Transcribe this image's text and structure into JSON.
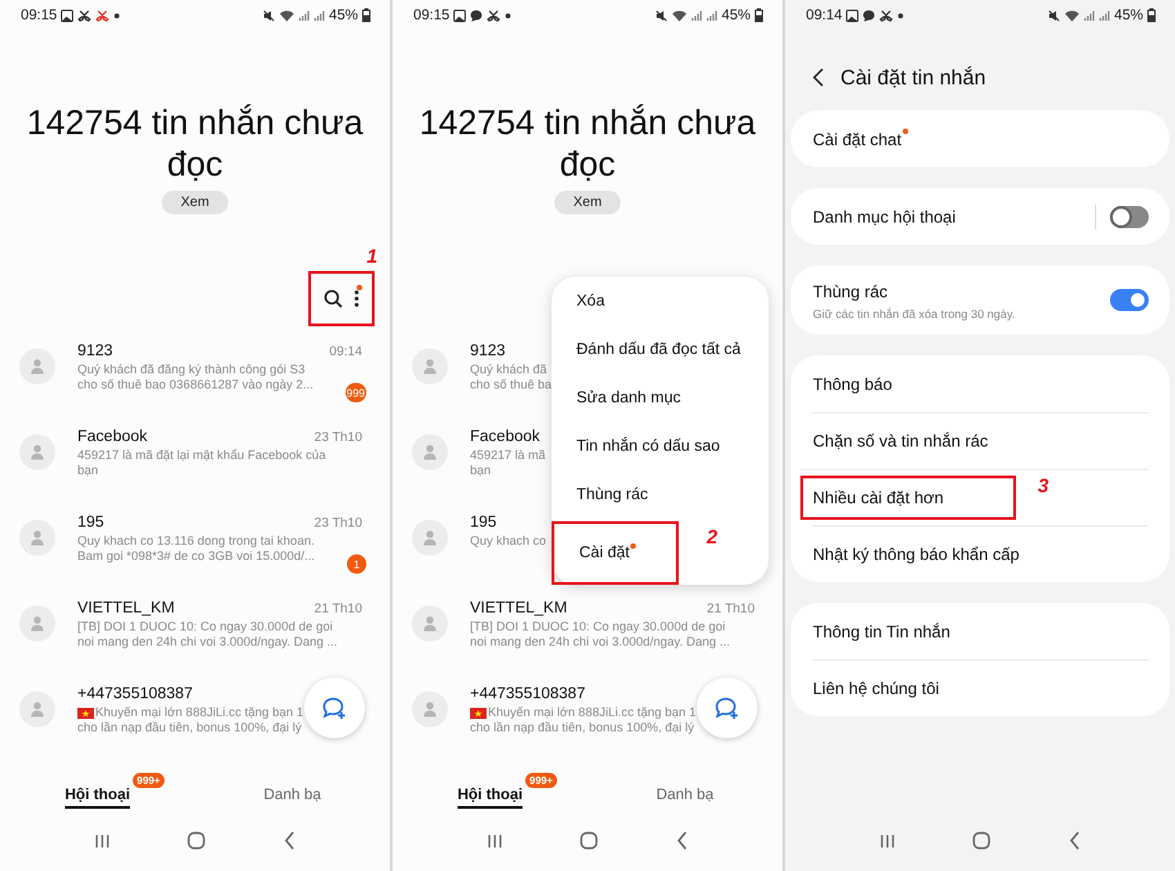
{
  "panels": [
    {
      "kind": "conversations",
      "status_bar": {
        "time": "09:15",
        "notification_icons": [
          {
            "kind": "image"
          },
          {
            "kind": "call"
          },
          {
            "kind": "missed-call"
          },
          {
            "kind": "dot"
          }
        ],
        "battery": "45%"
      },
      "title": "142754 tin nhắn chưa đọc",
      "view_button": "Xem",
      "toolbar": {
        "more_dot": true,
        "highlighted": true,
        "annotation": "1"
      },
      "conversations": [
        {
          "name": "9123",
          "time": "09:14",
          "lines": [
            "Quý khách đã đăng ký thành công gói S3",
            "cho số thuê bao 0368661287 vào ngày 2..."
          ],
          "badge": "999"
        },
        {
          "name": "Facebook",
          "time": "23 Th10",
          "lines": [
            "459217 là mã đặt lại mật khẩu Facebook của",
            "bạn"
          ]
        },
        {
          "name": "195",
          "time": "23 Th10",
          "lines": [
            "Quy khach co 13.116 dong trong tai khoan.",
            "Bam goi *098*3# de co 3GB voi 15.000d/..."
          ],
          "badge": "1"
        },
        {
          "name": "VIETTEL_KM",
          "time": "21 Th10",
          "lines": [
            "[TB] DOI 1 DUOC 10: Co ngay 30.000d de goi",
            "noi mang den 24h chi voi 3.000d/ngay. Dang ..."
          ]
        },
        {
          "name": "+447355108387",
          "flag": true,
          "lines": [
            "Khuyến mại lớn 888JiLi.cc tặng bạn 1",
            "cho lần nạp đầu tiên, bonus 100%, đại lý"
          ]
        }
      ],
      "tabs": [
        {
          "label": "Hội thoại",
          "selected": true,
          "badge": "999+"
        },
        {
          "label": "Danh bạ",
          "selected": false
        }
      ]
    },
    {
      "kind": "conversations",
      "status_bar": {
        "time": "09:15",
        "notification_icons": [
          {
            "kind": "image"
          },
          {
            "kind": "chat"
          },
          {
            "kind": "call"
          },
          {
            "kind": "dot"
          }
        ],
        "battery": "45%"
      },
      "title": "142754 tin nhắn chưa đọc",
      "view_button": "Xem",
      "conversations": [
        {
          "name": "9123",
          "lines": [
            "Quý khách đã",
            "cho số thuê ba"
          ]
        },
        {
          "name": "Facebook",
          "lines": [
            "459217 là mã",
            "bạn"
          ]
        },
        {
          "name": "195",
          "lines": [
            "Quy khach co"
          ]
        },
        {
          "name": "VIETTEL_KM",
          "time": "21 Th10",
          "lines": [
            "[TB] DOI 1 DUOC 10: Co ngay 30.000d de goi",
            "noi mang den 24h chi voi 3.000d/ngay. Dang ..."
          ]
        },
        {
          "name": "+447355108387",
          "flag": true,
          "lines": [
            "Khuyến mại lớn 888JiLi.cc tặng bạn 1",
            "cho lần nạp đầu tiên, bonus 100%, đại lý"
          ]
        }
      ],
      "menu": [
        {
          "label": "Xóa"
        },
        {
          "label": "Đánh dấu đã đọc tất cả"
        },
        {
          "label": "Sửa danh mục"
        },
        {
          "label": "Tin nhắn có dấu sao"
        },
        {
          "label": "Thùng rác"
        },
        {
          "label": "Cài đặt",
          "dot": true,
          "highlighted": true,
          "annotation": "2"
        }
      ],
      "tabs": [
        {
          "label": "Hội thoại",
          "selected": true,
          "badge": "999+"
        },
        {
          "label": "Danh bạ",
          "selected": false
        }
      ]
    },
    {
      "kind": "settings",
      "status_bar": {
        "time": "09:14",
        "notification_icons": [
          {
            "kind": "image"
          },
          {
            "kind": "chat"
          },
          {
            "kind": "call"
          },
          {
            "kind": "dot"
          }
        ],
        "battery": "45%"
      },
      "title": "Cài đặt tin nhắn",
      "groups": [
        [
          {
            "kind": "link",
            "label": "Cài đặt chat",
            "dot": true
          }
        ],
        [
          {
            "kind": "toggle",
            "label": "Danh mục hội thoại",
            "on": false
          }
        ],
        [
          {
            "kind": "toggle",
            "label": "Thùng rác",
            "subtitle": "Giữ các tin nhắn đã xóa trong 30 ngày.",
            "on": true
          }
        ],
        [
          {
            "kind": "link",
            "label": "Thông báo"
          },
          {
            "kind": "link",
            "label": "Chặn số và tin nhắn rác"
          },
          {
            "kind": "link",
            "label": "Nhiều cài đặt hơn",
            "highlighted": true,
            "annotation": "3"
          },
          {
            "kind": "link",
            "label": "Nhật ký thông báo khẩn cấp"
          }
        ],
        [
          {
            "kind": "link",
            "label": "Thông tin Tin nhắn"
          },
          {
            "kind": "link",
            "label": "Liên hệ chúng tôi"
          }
        ]
      ]
    }
  ]
}
